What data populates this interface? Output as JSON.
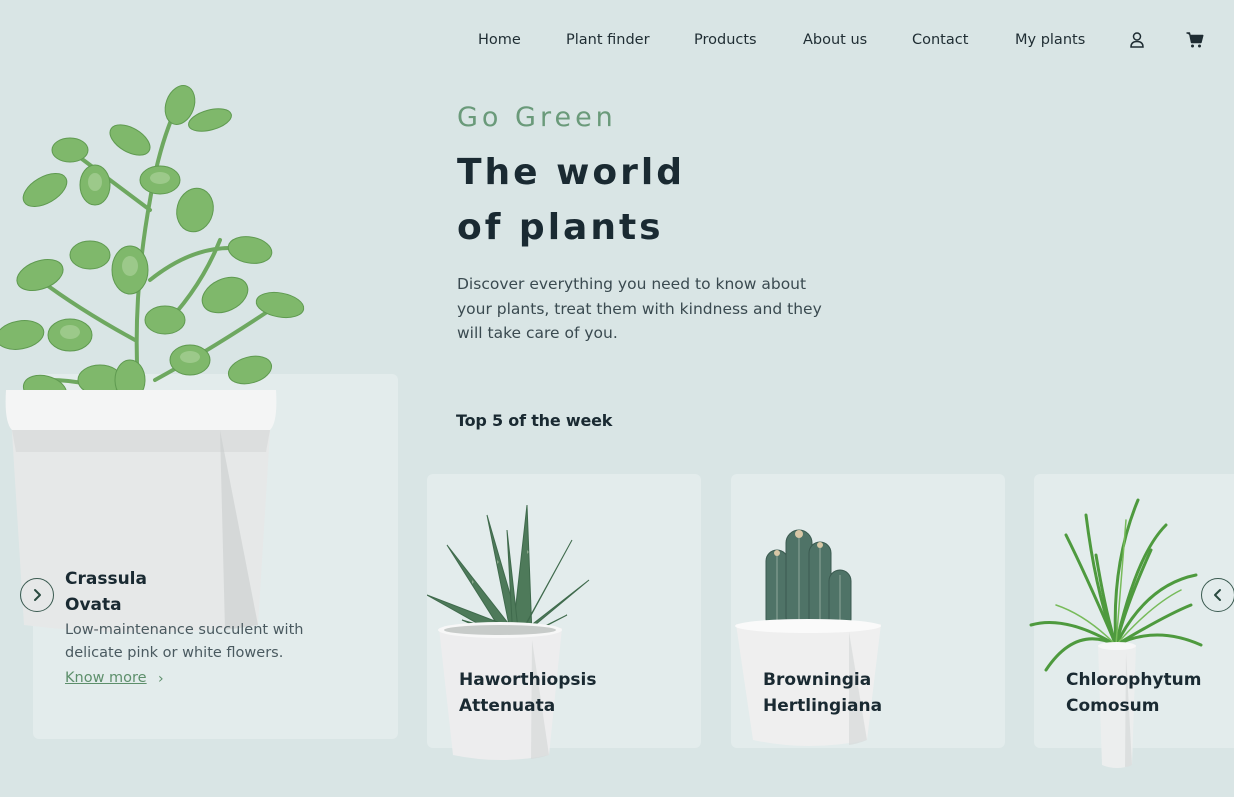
{
  "nav": {
    "items": [
      "Home",
      "Plant finder",
      "Products",
      "About us",
      "Contact",
      "My plants"
    ],
    "icons": [
      "user-icon",
      "cart-icon"
    ]
  },
  "hero": {
    "eyebrow": "Go Green",
    "title_line1": "The world",
    "title_line2": "of plants",
    "description": "Discover everything you need to know about your plants, treat them with kindness and they will take care of you."
  },
  "top_section": {
    "title": "Top 5 of the week"
  },
  "featured": {
    "name_line1": "Crassula",
    "name_line2": "Ovata",
    "description": "Low-maintenance succulent with delicate pink or white flowers.",
    "link_label": "Know more",
    "link_arrow": "›"
  },
  "products": [
    {
      "name_line1": "Haworthiopsis",
      "name_line2": "Attenuata"
    },
    {
      "name_line1": "Browningia",
      "name_line2": "Hertlingiana"
    },
    {
      "name_line1": "Chlorophytum",
      "name_line2": "Comosum"
    }
  ],
  "colors": {
    "background": "#d9e5e5",
    "card": "#e3ecec",
    "accent_green": "#6a9a7a",
    "text_dark": "#1a2a32"
  }
}
